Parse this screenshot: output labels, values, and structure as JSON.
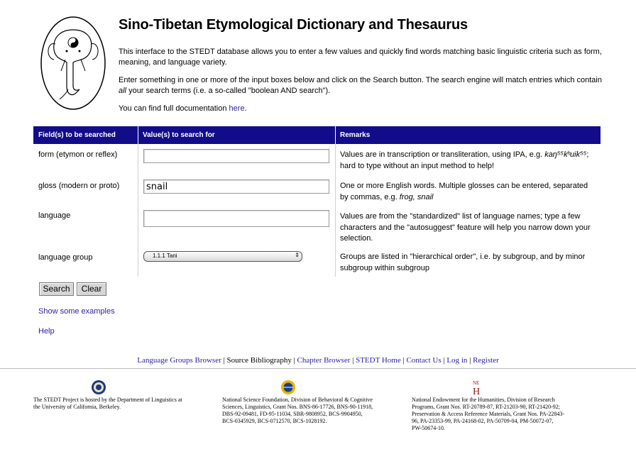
{
  "header": {
    "title": "Sino-Tibetan Etymological Dictionary and Thesaurus",
    "intro1": "This interface to the STEDT database allows you to enter a few values and quickly find words matching basic linguistic criteria such as form, meaning, and language variety.",
    "intro2_a": "Enter something in one or more of the input boxes below and click on the Search button. The search engine will match entries which contain ",
    "intro2_all": "all",
    "intro2_b": " your search terms (i.e. a so-called \"boolean AND search\").",
    "doc_prefix": "You can find full documentation ",
    "doc_link": "here",
    "doc_suffix": "."
  },
  "table": {
    "col1": "Field(s) to be searched",
    "col2": "Value(s) to search for",
    "col3": "Remarks",
    "rows": [
      {
        "label": "form (etymon or reflex)",
        "value": "",
        "remark_a": "Values are in transcription or transliteration, using IPA, e.g. ",
        "remark_i": "kaŋ⁵⁵kʰuik⁵⁵",
        "remark_b": "; hard to type without an input method to help!"
      },
      {
        "label": "gloss (modern or proto)",
        "value": "snail",
        "remark_a": "One or more English words. Multiple glosses can be entered, separated by commas, e.g. ",
        "remark_i": "frog, snail",
        "remark_b": ""
      },
      {
        "label": "language",
        "value": "",
        "remark": "Values are from the \"standardized\" list of language names; type a few characters and the \"autosuggest\" feature will help you narrow down your selection."
      },
      {
        "label": "language group",
        "select": "1.1.1 Tani",
        "remark": "Groups are listed in \"hierarchical order\", i.e. by subgroup, and by minor subgroup within subgroup"
      }
    ]
  },
  "buttons": {
    "search": "Search",
    "clear": "Clear"
  },
  "links": {
    "examples": "Show some examples",
    "help": "Help"
  },
  "footer_links": [
    "Language Groups Browser",
    "Source Bibliography",
    "Chapter Browser",
    "STEDT Home",
    "Contact Us",
    "Log in",
    "Register"
  ],
  "footer": {
    "ucb": "The STEDT Project is hosted by the Department of Linguistics at the University of California, Berkeley.",
    "nsf": "National Science Foundation, Division of Behavioral & Cognitive Sciences, Linguistics, Grant Nos. BNS-86-17726, BNS-90-11918, DBS-92-09481, FD-95-11034, SBR-9808952, BCS-9904950, BCS-0345929, BCS-0712570, BCS-1028192.",
    "neh_logo_text": "NE H",
    "neh": "National Endowment for the Humanities, Division of Research Programs, Grant Nos. RT-20789-87, RT-21203-90, RT-21420-92; Preservation & Access Reference Materials, Grant Nos. PA-22843-96, PA-23353-99, PA-24168-02, PA-50709-04, PM-50072-07, PW-50674-10."
  }
}
